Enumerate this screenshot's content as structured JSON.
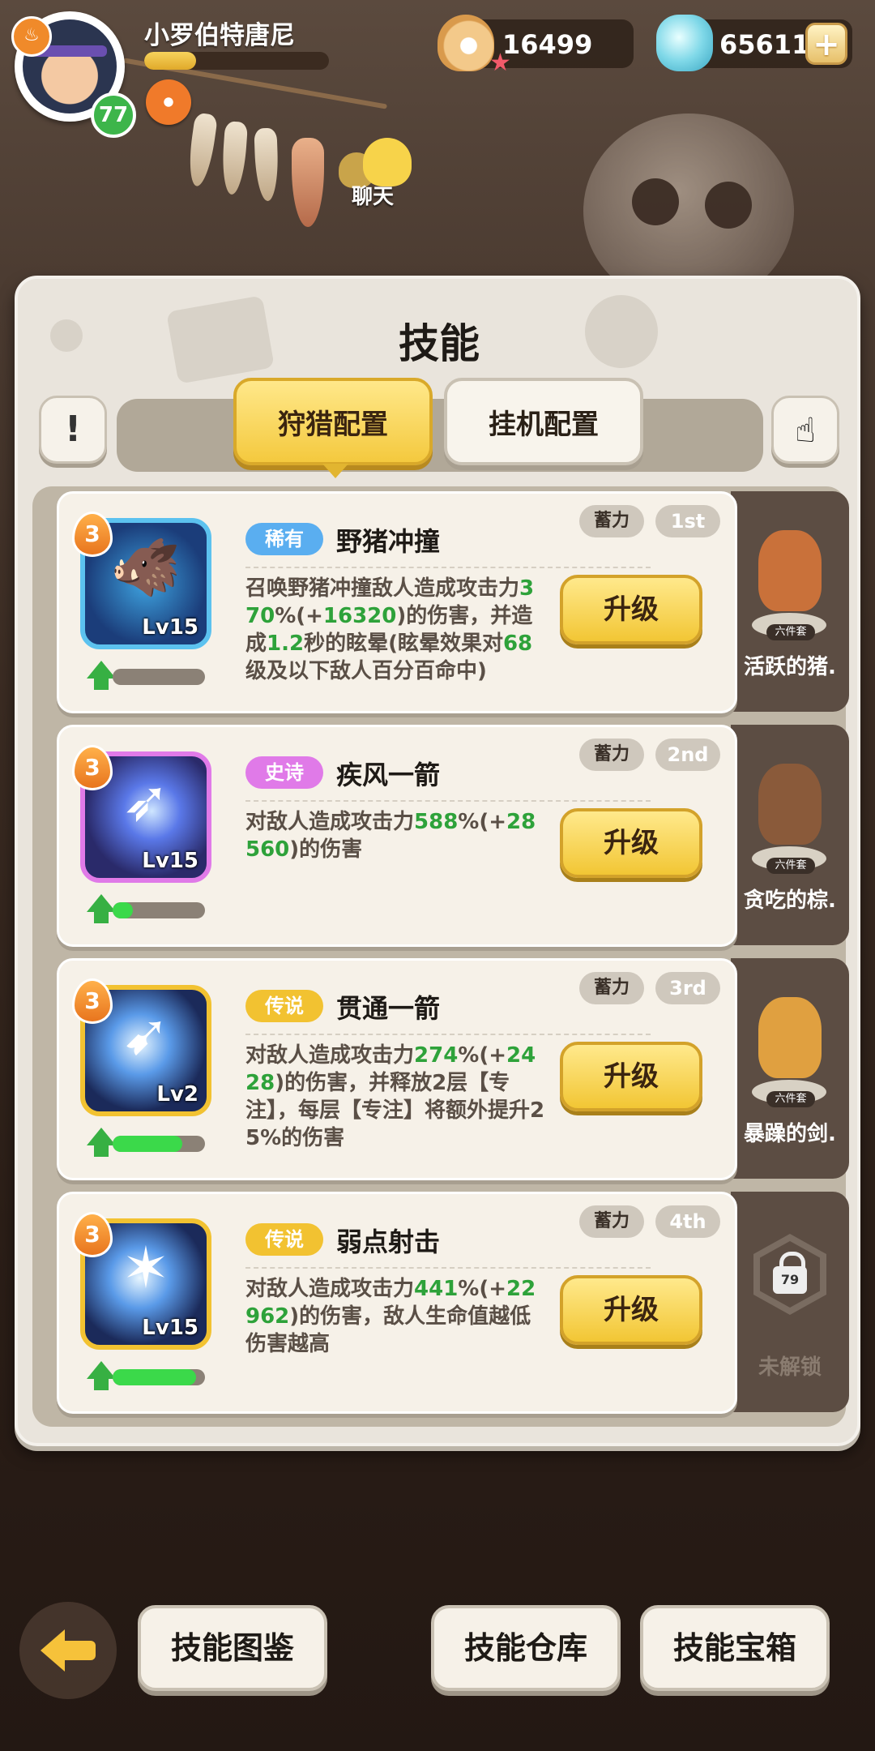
{
  "header": {
    "player_name": "小罗伯特唐尼",
    "level": "77",
    "xp_fraction": 0.28,
    "pearls": "16499",
    "gems": "656116",
    "chat_label": "聊天"
  },
  "panel": {
    "title": "技能",
    "info_icon": "!",
    "tabs": [
      {
        "label": "狩猎配置",
        "active": true
      },
      {
        "label": "挂机配置",
        "active": false
      }
    ]
  },
  "skills": [
    {
      "rank": "3",
      "level_label": "Lv15",
      "rarity": "稀有",
      "rarity_color": "#5aaef0",
      "name": "野猪冲撞",
      "charge": "蓄力",
      "order": "1st",
      "desc_parts": [
        "召唤野猪冲撞敌人造成攻击力",
        "370",
        "%(+",
        "16320",
        ")的伤害，并造成",
        "1.2",
        "秒的眩晕(眩晕效果对",
        "68",
        "级及以下敌人百分百命中)"
      ],
      "upgrade": "升级",
      "progress": 0.0,
      "side_name": "活跃的猪.",
      "side_tag": "六件套",
      "locked": false
    },
    {
      "rank": "3",
      "level_label": "Lv15",
      "rarity": "史诗",
      "rarity_color": "#e07ae8",
      "name": "疾风一箭",
      "charge": "蓄力",
      "order": "2nd",
      "desc_parts": [
        "对敌人造成攻击力",
        "588",
        "%(+",
        "28560",
        ")的伤害"
      ],
      "upgrade": "升级",
      "progress": 0.22,
      "side_name": "贪吃的棕.",
      "side_tag": "六件套",
      "locked": false
    },
    {
      "rank": "3",
      "level_label": "Lv2",
      "rarity": "传说",
      "rarity_color": "#f2c231",
      "name": "贯通一箭",
      "charge": "蓄力",
      "order": "3rd",
      "desc_parts": [
        "对敌人造成攻击力",
        "274",
        "%(+",
        "2428",
        ")的伤害，并释放2层【专注】，每层【专注】将额外提升25%的伤害"
      ],
      "upgrade": "升级",
      "progress": 0.75,
      "side_name": "暴躁的剑.",
      "side_tag": "六件套",
      "locked": false
    },
    {
      "rank": "3",
      "level_label": "Lv15",
      "rarity": "传说",
      "rarity_color": "#f2c231",
      "name": "弱点射击",
      "charge": "蓄力",
      "order": "4th",
      "desc_parts": [
        "对敌人造成攻击力",
        "441",
        "%(+",
        "22962",
        ")的伤害，敌人生命值越低伤害越高"
      ],
      "upgrade": "升级",
      "progress": 0.9,
      "side_name": "未解锁",
      "side_lock_level": "79",
      "locked": true
    }
  ],
  "footer": {
    "buttons": [
      "技能图鉴",
      "技能仓库",
      "技能宝箱"
    ]
  },
  "icons": [
    "flame-icon",
    "pearl-icon",
    "gem-icon",
    "plus-icon",
    "chat-icon",
    "info-icon",
    "pointer-hand-icon",
    "up-arrow-icon",
    "lock-icon",
    "back-arrow-icon"
  ]
}
